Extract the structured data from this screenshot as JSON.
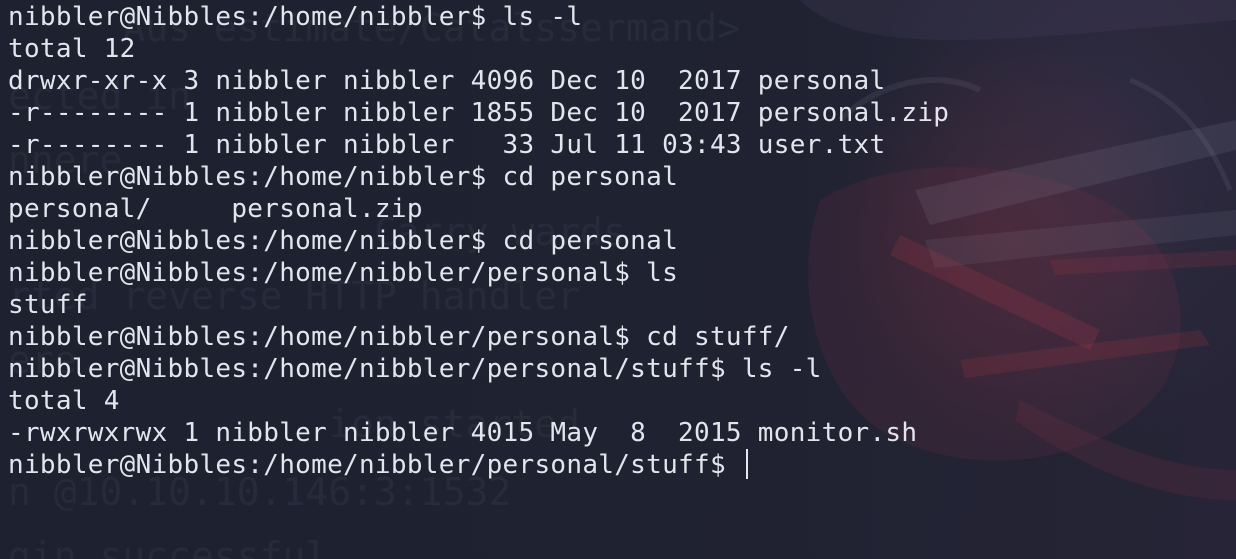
{
  "terminal": {
    "lines": [
      "nibbler@Nibbles:/home/nibbler$ ls -l",
      "total 12",
      "drwxr-xr-x 3 nibbler nibbler 4096 Dec 10  2017 personal",
      "-r-------- 1 nibbler nibbler 1855 Dec 10  2017 personal.zip",
      "-r-------- 1 nibbler nibbler   33 Jul 11 03:43 user.txt",
      "nibbler@Nibbles:/home/nibbler$ cd personal",
      "personal/     personal.zip",
      "nibbler@Nibbles:/home/nibbler$ cd personal",
      "nibbler@Nibbles:/home/nibbler/personal$ ls",
      "stuff",
      "nibbler@Nibbles:/home/nibbler/personal$ cd stuff/",
      "nibbler@Nibbles:/home/nibbler/personal/stuff$ ls -l",
      "total 4",
      "-rwxrwxrwx 1 nibbler nibbler 4015 May  8  2015 monitor.sh"
    ],
    "prompt": "nibbler@Nibbles:/home/nibbler/personal/stuff$ "
  },
  "colors": {
    "background": "#1f2230",
    "foreground": "#e3e5ec"
  }
}
